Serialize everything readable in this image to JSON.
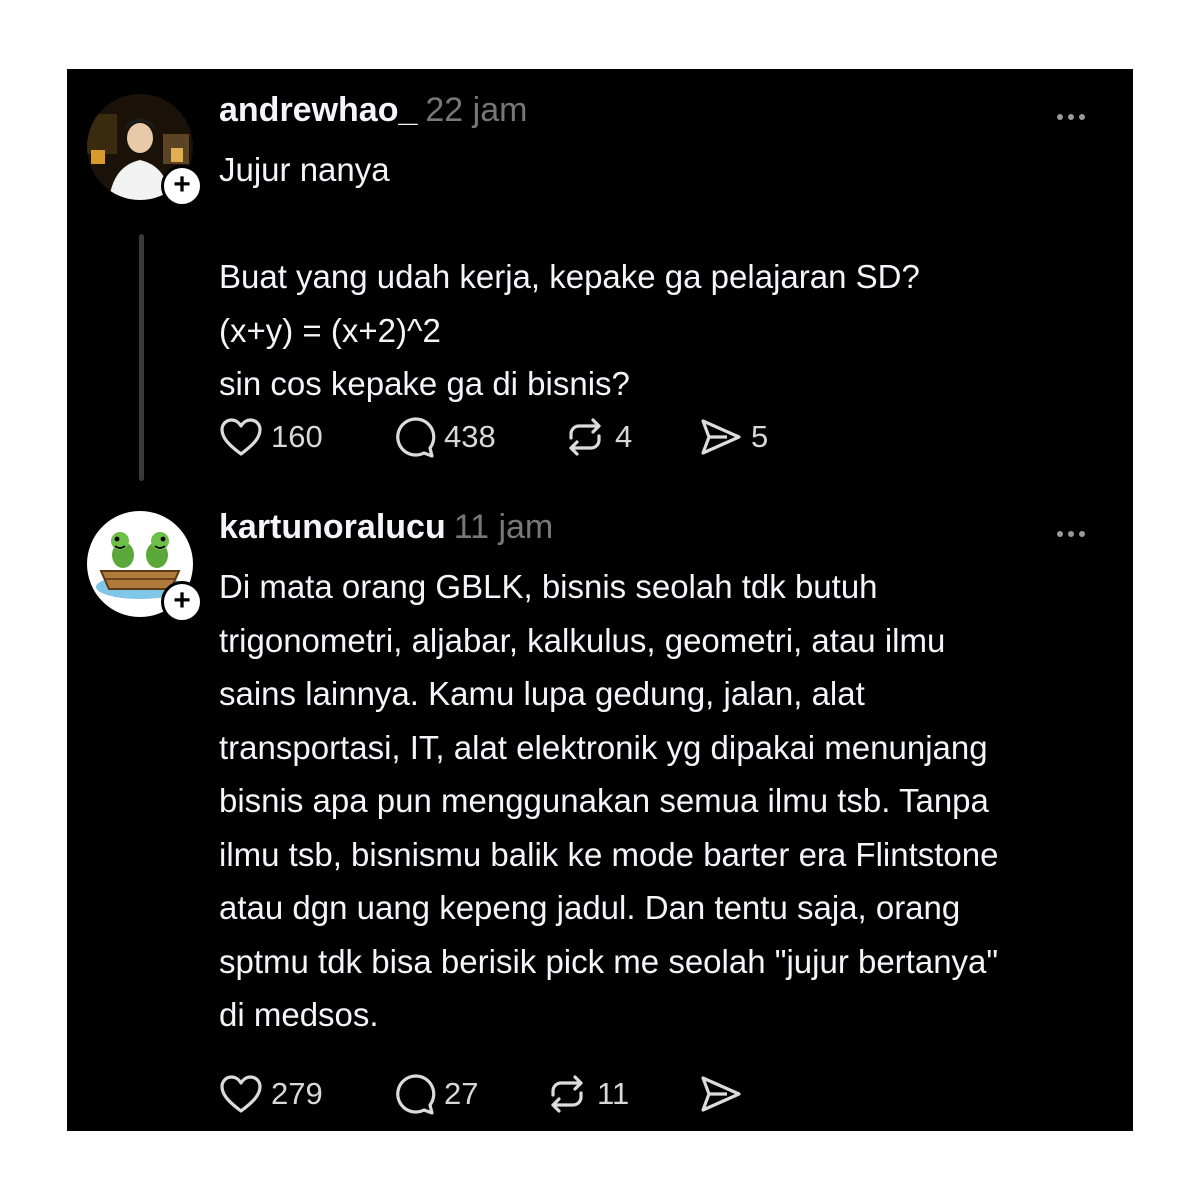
{
  "post1": {
    "username": "andrewhao_",
    "time": "22 jam",
    "follow_symbol": "+",
    "lines": [
      "Jujur nanya",
      "",
      "Buat yang udah kerja, kepake ga pelajaran SD?",
      "(x+y) = (x+2)^2",
      "sin cos kepake ga di bisnis?"
    ],
    "likes": "160",
    "comments": "438",
    "reposts": "4",
    "shares": "5"
  },
  "post2": {
    "username": "kartunoralucu",
    "time": "11 jam",
    "follow_symbol": "+",
    "lines": [
      "Di mata orang GBLK, bisnis seolah tdk butuh",
      "trigonometri, aljabar, kalkulus, geometri, atau ilmu",
      "sains lainnya. Kamu lupa gedung, jalan, alat",
      "transportasi, IT, alat elektronik yg dipakai menunjang",
      "bisnis apa pun menggunakan semua ilmu tsb. Tanpa",
      "ilmu tsb, bisnismu balik ke mode barter era Flintstone",
      "atau dgn uang kepeng jadul. Dan tentu saja, orang",
      "sptmu tdk bisa berisik pick me seolah \"jujur bertanya\"",
      "di medsos."
    ],
    "likes": "279",
    "comments": "27",
    "reposts": "11"
  },
  "icons": {
    "like": "heart-icon",
    "comment": "comment-bubble-icon",
    "repost": "repost-icon",
    "share": "send-icon",
    "more": "more-dots-icon"
  },
  "colors": {
    "background": "#000000",
    "text": "#f3f5f7",
    "muted": "#777777"
  }
}
